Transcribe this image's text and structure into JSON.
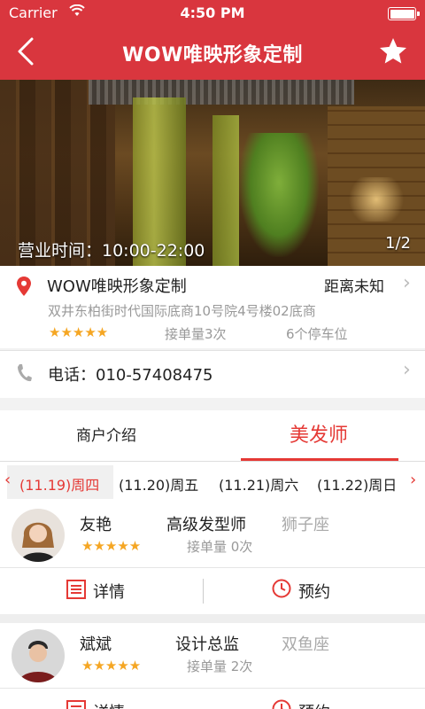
{
  "status_bar": {
    "carrier": "Carrier",
    "time": "4:50 PM"
  },
  "nav": {
    "title": "WOW唯映形象定制"
  },
  "hero": {
    "hours": "营业时间：10:00-22:00",
    "pager": "1/2"
  },
  "shop": {
    "name": "WOW唯映形象定制",
    "distance": "距离未知",
    "address": "双井东柏街时代国际底商10号院4号楼02底商",
    "rating_stars": "★★★★★",
    "orders": "接单量3次",
    "parking": "6个停车位",
    "phone": "电话：010-57408475"
  },
  "tabs": [
    {
      "label": "商户介绍"
    },
    {
      "label": "美发师"
    }
  ],
  "dates": [
    {
      "label": "(11.19)周四"
    },
    {
      "label": "(11.20)周五"
    },
    {
      "label": "(11.21)周六"
    },
    {
      "label": "(11.22)周日"
    }
  ],
  "stylists": [
    {
      "name": "友艳",
      "title": "高级发型师",
      "sign": "狮子座",
      "stars": "★★★★★",
      "orders": "接单量 0次",
      "details": "详情",
      "book": "预约"
    },
    {
      "name": "斌斌",
      "title": "设计总监",
      "sign": "双鱼座",
      "stars": "★★★★★",
      "orders": "接单量 2次",
      "details": "详情",
      "book": "预约"
    }
  ],
  "colors": {
    "brand_red": "#d9363e",
    "accent": "#e53935",
    "star": "#f5a623"
  }
}
